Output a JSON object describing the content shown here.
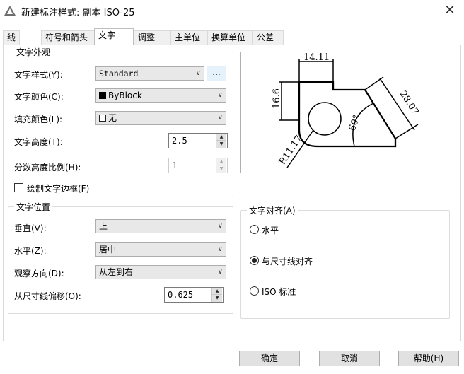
{
  "window": {
    "title": "新建标注样式: 副本 ISO-25",
    "close_glyph": "✕"
  },
  "tabs": [
    {
      "label": "线"
    },
    {
      "label": "符号和箭头"
    },
    {
      "label": "文字"
    },
    {
      "label": "调整"
    },
    {
      "label": "主单位"
    },
    {
      "label": "换算单位"
    },
    {
      "label": "公差"
    }
  ],
  "text_appearance": {
    "group_title": "文字外观",
    "style_label": "文字样式(Y):",
    "style_value": "Standard",
    "style_button": "...",
    "color_label": "文字颜色(C):",
    "color_value": "ByBlock",
    "color_swatch": "#000000",
    "fill_label": "填充颜色(L):",
    "fill_value": "无",
    "height_label": "文字高度(T):",
    "height_value": "2.5",
    "fraction_label": "分数高度比例(H):",
    "fraction_value": "1",
    "frame_label": "绘制文字边框(F)",
    "frame_checked": false
  },
  "text_placement": {
    "group_title": "文字位置",
    "vertical_label": "垂直(V):",
    "vertical_value": "上",
    "horizontal_label": "水平(Z):",
    "horizontal_value": "居中",
    "view_dir_label": "观察方向(D):",
    "view_dir_value": "从左到右",
    "offset_label": "从尺寸线偏移(O):",
    "offset_value": "0.625"
  },
  "text_alignment": {
    "group_title": "文字对齐(A)",
    "options": [
      {
        "label": "水平",
        "checked": false
      },
      {
        "label": "与尺寸线对齐",
        "checked": true
      },
      {
        "label": "ISO 标准",
        "checked": false
      }
    ]
  },
  "preview": {
    "dim_top": "14.11",
    "dim_left": "16.6",
    "dim_right": "28.07",
    "dim_angle": "60°",
    "dim_radius": "R11.17"
  },
  "buttons": {
    "ok": "确定",
    "cancel": "取消",
    "help": "帮助(H)"
  }
}
